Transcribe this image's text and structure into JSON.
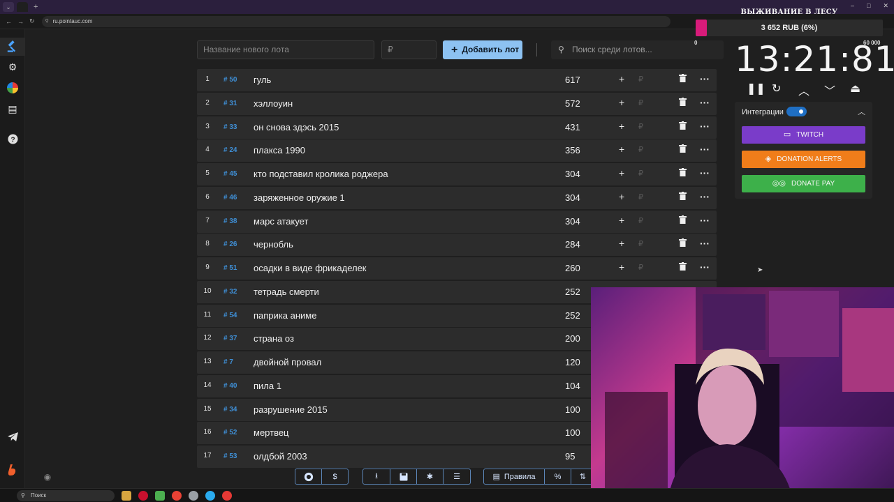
{
  "browser": {
    "url": "ru.pointauc.com",
    "window_controls": [
      "–",
      "□",
      "✕"
    ]
  },
  "topbar": {
    "new_lot_placeholder": "Название нового лота",
    "amount_placeholder": "₽",
    "add_button_label": "Добавить лот",
    "search_placeholder": "Поиск среди лотов..."
  },
  "lots": [
    {
      "index": "1",
      "tag": "# 50",
      "name": "гуль",
      "amount": "617"
    },
    {
      "index": "2",
      "tag": "# 31",
      "name": "хэллоуин",
      "amount": "572"
    },
    {
      "index": "3",
      "tag": "# 33",
      "name": "он снова здэсь 2015",
      "amount": "431"
    },
    {
      "index": "4",
      "tag": "# 24",
      "name": "плакса 1990",
      "amount": "356"
    },
    {
      "index": "5",
      "tag": "# 45",
      "name": "кто подставил кролика роджера",
      "amount": "304"
    },
    {
      "index": "6",
      "tag": "# 46",
      "name": "заряженное оружие 1",
      "amount": "304"
    },
    {
      "index": "7",
      "tag": "# 38",
      "name": "марс атакует",
      "amount": "304"
    },
    {
      "index": "8",
      "tag": "# 26",
      "name": "чернобль",
      "amount": "284"
    },
    {
      "index": "9",
      "tag": "# 51",
      "name": "осадки в виде фрикаделек",
      "amount": "260"
    },
    {
      "index": "10",
      "tag": "# 32",
      "name": "тетрадь смерти",
      "amount": "252"
    },
    {
      "index": "11",
      "tag": "# 54",
      "name": "паприка аниме",
      "amount": "252"
    },
    {
      "index": "12",
      "tag": "# 37",
      "name": "страна оз",
      "amount": "200"
    },
    {
      "index": "13",
      "tag": "# 7",
      "name": " двойной провал",
      "amount": "120"
    },
    {
      "index": "14",
      "tag": "# 40",
      "name": "пила 1",
      "amount": "104"
    },
    {
      "index": "15",
      "tag": "# 34",
      "name": "разрушение 2015",
      "amount": "100"
    },
    {
      "index": "16",
      "tag": "# 52",
      "name": "мертвец",
      "amount": "100"
    },
    {
      "index": "17",
      "tag": "# 53",
      "name": "олдбой 2003",
      "amount": "95"
    }
  ],
  "row_controls": {
    "plus": "+",
    "rub": "₽",
    "delete_icon": "trash-icon",
    "more": "···"
  },
  "bottombar": {
    "rules_label": "Правила",
    "percent_label": "%",
    "dollar_label": "$"
  },
  "auction": {
    "title": "ВЫЖИВАНИЕ В ЛЕСУ",
    "progress_text": "3 652 RUB (6%)",
    "progress_fraction": 0.06,
    "progress_min": "0",
    "progress_max": "60 000",
    "timer": "13:21:81"
  },
  "integrations": {
    "label": "Интеграции",
    "enabled": true,
    "services": [
      {
        "label": "TWITCH",
        "color": "#7a3cc9",
        "icon": "twitch-icon"
      },
      {
        "label": "DONATION ALERTS",
        "color": "#f07d1a",
        "icon": "donationalerts-icon"
      },
      {
        "label": "DONATE PAY",
        "color": "#3db04a",
        "icon": "donatepay-icon"
      }
    ]
  },
  "taskbar": {
    "search_label": "Поиск"
  },
  "colors": {
    "accent": "#8dc2f2",
    "tag_blue": "#3f8fd6",
    "progress_pink": "#d81b7a",
    "row_bg": "#2c2c2c"
  }
}
